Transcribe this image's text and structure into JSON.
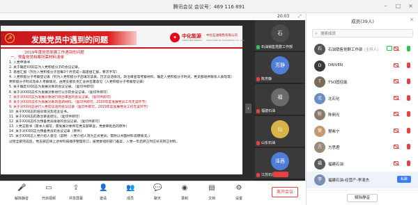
{
  "window": {
    "title": "腾讯会议 会议号：469 116 891",
    "time": "20:03"
  },
  "slide": {
    "title": "发展党员中遇到的问题",
    "logo_brand": "中化能源",
    "logo_brand_en": "SINOCHEM ENERGY",
    "logo_company": "中化石油销售有限公司",
    "logo_company_en": "SINOCHEM OIL MARKETING CO., LTD.",
    "heading1": "2019年度党员发展工作遇到的问题",
    "heading2": "一、预备党员档案所需材料清单",
    "items": [
      {
        "text": "1. 入党申请书",
        "red": false
      },
      {
        "text": "2. 关于确定XX同志为入党积极分子的会议记录。",
        "red": false
      },
      {
        "text": "3. 思想汇报（列为入党积极分子后每3个月完成一篇思想汇报，要求手写）",
        "red": false
      },
      {
        "text": "4. 入党积极分子考察登记表（列为入党积极分子后填写该表，历次谈话情况，政治审查等考察材料，确定入党积极分子时间，党支部培养联系人表现等）",
        "red": false
      },
      {
        "text": "   党积极分子时间及本人考察情况，由党支部负责汇总并签署意见（入党积极分子考察登记表）",
        "red": false
      },
      {
        "text": "5. 关于确定XX同志为发展对象的会议记录。（复印件即可）",
        "red": false
      },
      {
        "text": "6. 关于对XX同志作为发展对象进行公示的会议记录。（复印件即可）",
        "red": false
      },
      {
        "text": "7. 关于对XX同志为发展对象进行政治审查的会议记录。（复印件即可）",
        "red": true
      },
      {
        "text": "8. 关于对XX同志作为发展对象的函调材料。（复印件即可，2020年度发展党员工作无该环节）",
        "red": true
      },
      {
        "text": "9. 关于对XX同志进行入党前谈话的会议记录（复印件即可，2019年度发展党员工作无该环节）",
        "red": true
      },
      {
        "text": "10. 关于XX同志的培训情况及结业证书。",
        "red": false
      },
      {
        "text": "11. 关于XX同志的政治审查结论。（复印件即可）",
        "red": false
      },
      {
        "text": "12. 关于XX同志作为预备党员接收的会议记录。（复印件即可）",
        "red": false
      },
      {
        "text": "13. 入党志愿书（需本人填写，需发展对象所在党支部审查，党委审批后的原件）",
        "red": false
      },
      {
        "text": "14. 关于对XX同志为预备党员的会议记录（原件）",
        "red": false
      },
      {
        "text": "15. 关于XX同志入党介绍人意见（说明：入党介绍人须为正式党员，需附以书面材料说明情况。）",
        "red": false
      },
      {
        "text": "   过程全部完成后，党支部应将上述材料按顺序整理装订，报党委组织部门备案，入党一年后转正时应补充转正材料。",
        "red": false
      }
    ]
  },
  "videos": [
    {
      "name": "石油销售党群工作部",
      "initial": "石",
      "color": "#4a4a4a",
      "mic": "on"
    },
    {
      "name": "陈芳静",
      "initial": "芳静",
      "color": "#4f7ed8",
      "mic": "off"
    },
    {
      "name": "福建石油",
      "initial": "福",
      "color": "#6a6a6a",
      "mic": "off"
    },
    {
      "name": "山东石油",
      "initial": "山",
      "color": "#d9b24a",
      "mic": "off"
    },
    {
      "name": "江苏石油",
      "initial": "泽茜",
      "color": "#4f7ed8",
      "mic": "off"
    }
  ],
  "toolbar": {
    "items": [
      {
        "label": "解除静音",
        "icon": "mic-muted-icon",
        "glyph": "🎤"
      },
      {
        "label": "开启视频",
        "icon": "camera-off-icon",
        "glyph": "▭"
      },
      {
        "label": "共享屏幕",
        "icon": "share-screen-icon",
        "glyph": "⇪"
      },
      {
        "label": "邀请",
        "icon": "invite-icon",
        "glyph": "👤"
      },
      {
        "label": "成员",
        "icon": "members-icon",
        "glyph": "👥"
      },
      {
        "label": "聊天",
        "icon": "chat-icon",
        "glyph": "💬"
      },
      {
        "label": "录制",
        "icon": "record-icon",
        "glyph": "◉"
      },
      {
        "label": "文档",
        "icon": "document-icon",
        "glyph": "▤"
      },
      {
        "label": "设置",
        "icon": "settings-icon",
        "glyph": "⚙"
      }
    ],
    "leave_label": "离开会议"
  },
  "panel": {
    "title": "成员(39人)",
    "search_placeholder": "搜索成员",
    "mute_all_label": "解除静音",
    "members": [
      {
        "name": "石油销售党群工作部",
        "role": "(主持人)",
        "initial": "石",
        "color": "#555555",
        "mic": "green",
        "screen": true,
        "pin": false
      },
      {
        "name": "DRIVEN",
        "role": "",
        "initial": "D",
        "color": "#3a3a3a",
        "mic": "red",
        "screen": false,
        "pin": false
      },
      {
        "name": "TSO固佳能",
        "role": "",
        "initial": "T",
        "color": "#7b6a5a",
        "mic": "red",
        "screen": false,
        "pin": false
      },
      {
        "name": "北石化",
        "role": "",
        "initial": "北",
        "color": "#6b8cc4",
        "mic": "red",
        "screen": false,
        "pin": false
      },
      {
        "name": "陈俐光",
        "role": "",
        "initial": "陈",
        "color": "#8a7a6a",
        "mic": "red",
        "screen": false,
        "pin": false
      },
      {
        "name": "樊希宁",
        "role": "",
        "initial": "樊",
        "color": "#c49a6c",
        "mic": "red",
        "screen": false,
        "pin": false
      },
      {
        "name": "方思君",
        "role": "",
        "initial": "方",
        "color": "#9a8a7a",
        "mic": "red",
        "screen": false,
        "pin": false
      },
      {
        "name": "福建石油",
        "role": "",
        "initial": "福",
        "color": "#5a5a5a",
        "mic": "red",
        "screen": false,
        "pin": false
      },
      {
        "name": "福建石油-经营产-李清杰",
        "role": "",
        "initial": "李",
        "color": "#7a8fb0",
        "mic": "red",
        "screen": false,
        "pin": true,
        "pin_label": "私聊"
      }
    ]
  },
  "colors": {
    "accent_red": "#c8161d",
    "mic_off": "#e84040",
    "mic_on": "#2fbf52",
    "brand_blue": "#3a7cf5"
  }
}
